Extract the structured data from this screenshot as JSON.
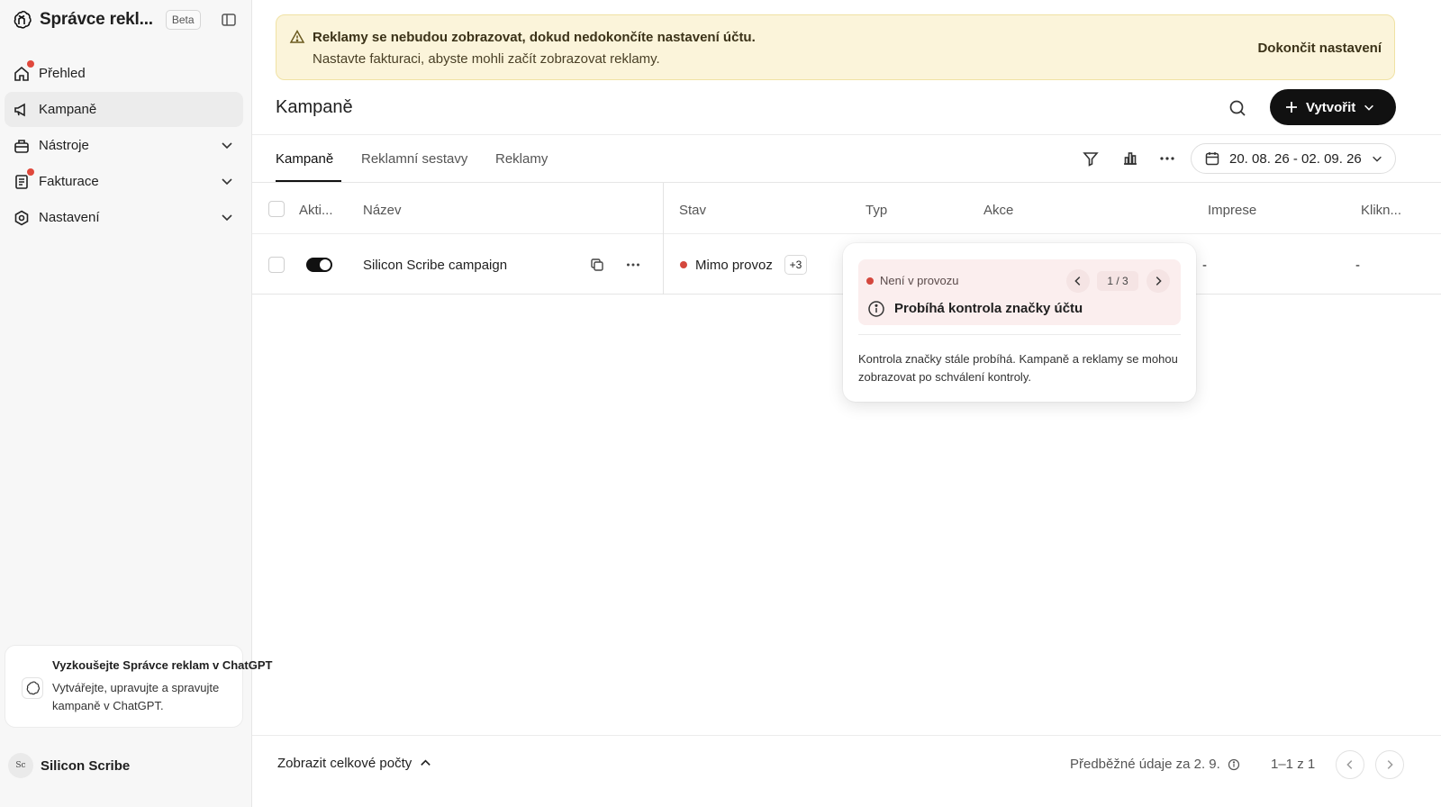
{
  "sidebar": {
    "brand_title": "Správce rekl...",
    "beta_label": "Beta",
    "items": [
      {
        "label": "Přehled",
        "icon": "home-icon"
      },
      {
        "label": "Kampaně",
        "icon": "megaphone-icon"
      },
      {
        "label": "Nástroje",
        "icon": "toolbox-icon"
      },
      {
        "label": "Fakturace",
        "icon": "receipt-icon"
      },
      {
        "label": "Nastavení",
        "icon": "gear-icon"
      }
    ],
    "promo": {
      "title": "Vyzkoušejte Správce reklam v ChatGPT",
      "text": "Vytvářejte, upravujte a spravujte kampaně v ChatGPT."
    },
    "user": {
      "name": "Silicon Scribe",
      "avatar_text": "Sc"
    }
  },
  "banner": {
    "title": "Reklamy se nebudou zobrazovat, dokud nedokončíte nastavení účtu.",
    "subtitle": "Nastavte fakturaci, abyste mohli začít zobrazovat reklamy.",
    "action": "Dokončit nastavení"
  },
  "header": {
    "title": "Kampaně",
    "create_label": "Vytvořit"
  },
  "tabs": [
    {
      "label": "Kampaně"
    },
    {
      "label": "Reklamní sestavy"
    },
    {
      "label": "Reklamy"
    }
  ],
  "toolbar": {
    "date_range": "20. 08. 26 - 02. 09. 26"
  },
  "table": {
    "columns": [
      "Akti...",
      "Název",
      "Stav",
      "Typ",
      "Akce",
      "Imprese",
      "Klikn..."
    ],
    "rows": [
      {
        "name": "Silicon Scribe campaign",
        "status": "Mimo provoz",
        "extra": "+3",
        "impressions": "-",
        "clicks": "-"
      }
    ]
  },
  "popover": {
    "status": "Není v provozu",
    "counter": "1 / 3",
    "title": "Probíhá kontrola značky účtu",
    "body": "Kontrola značky stále probíhá. Kampaně a reklamy se mohou zobrazovat po schválení kontroly."
  },
  "footer": {
    "totals_label": "Zobrazit celkové počty",
    "prelim": "Předběžné údaje za 2. 9.",
    "range": "1–1 z 1"
  },
  "colors": {
    "accent": "#111111",
    "banner_bg": "#fbf4da",
    "status_red": "#d4473d",
    "notification_dot": "#e0483c"
  }
}
